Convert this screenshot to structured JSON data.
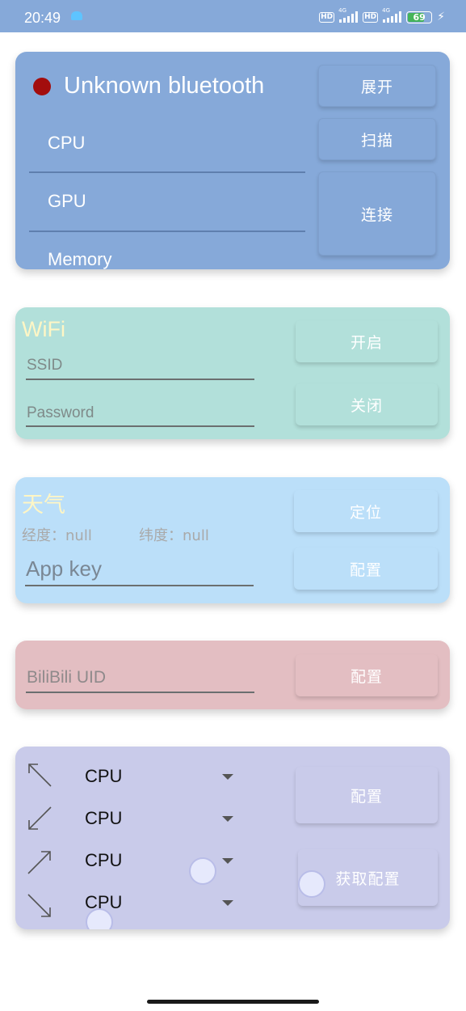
{
  "status_bar": {
    "time": "20:49",
    "network_label_1": "4G",
    "network_label_2": "4G",
    "hd_1": "HD",
    "hd_2": "HD",
    "battery": "69"
  },
  "bluetooth": {
    "title": "Unknown bluetooth",
    "status_color": "#a30d0d",
    "items": [
      "CPU",
      "GPU",
      "Memory"
    ],
    "expand_label": "展开",
    "scan_label": "扫描",
    "connect_label": "连接"
  },
  "wifi": {
    "title": "WiFi",
    "ssid_placeholder": "SSID",
    "password_placeholder": "Password",
    "on_label": "开启",
    "off_label": "关闭"
  },
  "weather": {
    "title": "天气",
    "longitude": "经度：null",
    "latitude": "纬度：null",
    "appkey_placeholder": "App key",
    "locate_label": "定位",
    "config_label": "配置"
  },
  "bilibili": {
    "uid_placeholder": "BiliBili UID",
    "config_label": "配置"
  },
  "layout": {
    "slots": [
      {
        "icon": "arrow-up-left-icon",
        "value": "CPU"
      },
      {
        "icon": "arrow-down-left-icon",
        "value": "CPU"
      },
      {
        "icon": "arrow-up-right-icon",
        "value": "CPU"
      },
      {
        "icon": "arrow-down-right-icon",
        "value": "CPU"
      }
    ],
    "config_label": "配置",
    "fetch_label": "获取配置"
  },
  "colors": {
    "bluetooth_card": "#86a9d9",
    "wifi_card": "#b2e0da",
    "weather_card": "#bbdff9",
    "bilibili_card": "#e3bec2",
    "layout_card": "#c9cbea",
    "title_yellow": "#fff6c5"
  }
}
